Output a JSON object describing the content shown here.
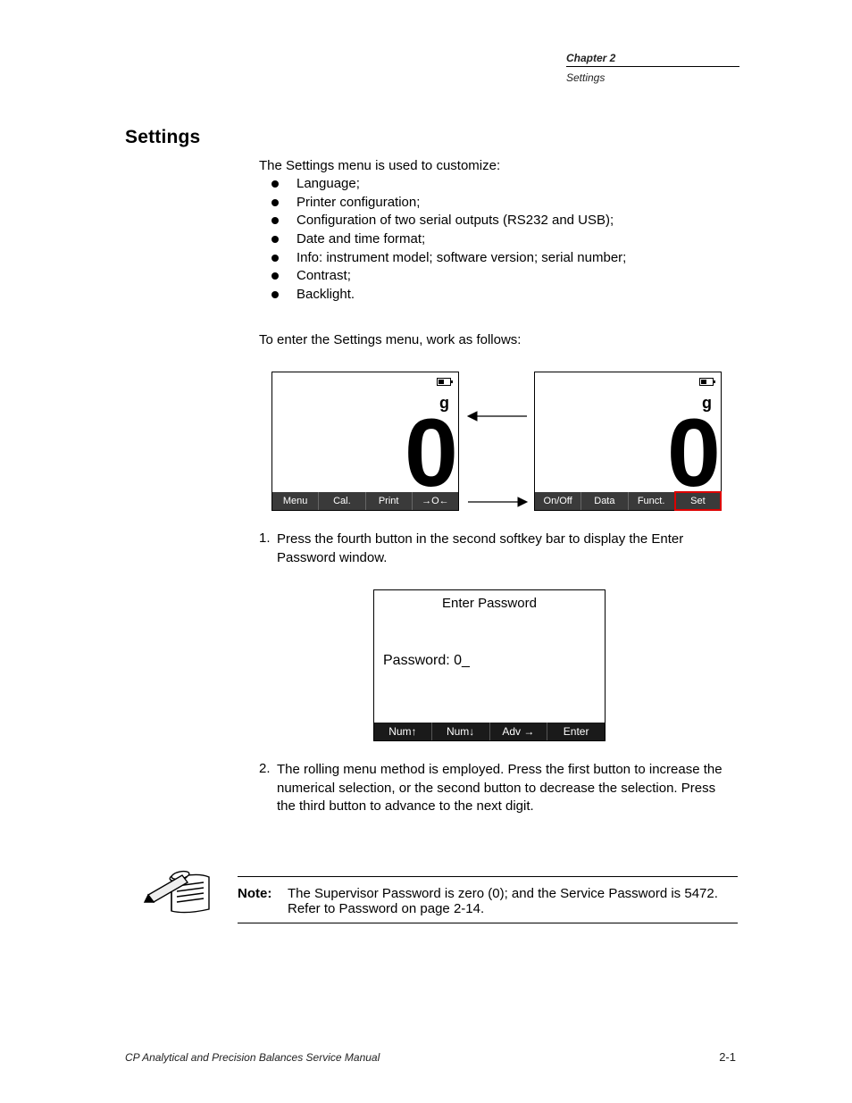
{
  "header": {
    "chapter": "Chapter 2",
    "section": "Settings"
  },
  "title": "Settings",
  "intro": "The Settings menu is used to customize:",
  "bullets": [
    "Language;",
    "Printer configuration;",
    "Configuration of two serial outputs (RS232 and USB);",
    "Date and time format;",
    "Info: instrument model; software version; serial number;",
    "Contrast;",
    "Backlight."
  ],
  "step_intro": "To enter the Settings menu, work as follows:",
  "screenA": {
    "unit": "g",
    "value": "0",
    "softkeys": [
      "Menu",
      "Cal.",
      "Print",
      "→O←"
    ]
  },
  "screenB": {
    "unit": "g",
    "value": "0",
    "softkeys": [
      "On/Off",
      "Data",
      "Funct.",
      "Set"
    ]
  },
  "step1": {
    "num": "1.",
    "text": "Press the fourth button in the second softkey bar to display the Enter Password window."
  },
  "screenC": {
    "title": "Enter Password",
    "pw_label": "Password:",
    "pw_value": "0_",
    "softkeys": [
      "Num↑",
      "Num↓",
      "Adv →",
      "Enter"
    ]
  },
  "step2": {
    "num": "2.",
    "text": "The rolling menu method is employed. Press the first button to increase the numerical selection, or the second button to decrease the selection. Press the third button to advance to the next digit."
  },
  "note": {
    "label": "Note:",
    "text": "The Supervisor Password is zero (0); and the Service Password is 5472. Refer to Password on page 2-14."
  },
  "footer": {
    "left": "CP Analytical and Precision Balances Service Manual",
    "right": "2-1"
  }
}
